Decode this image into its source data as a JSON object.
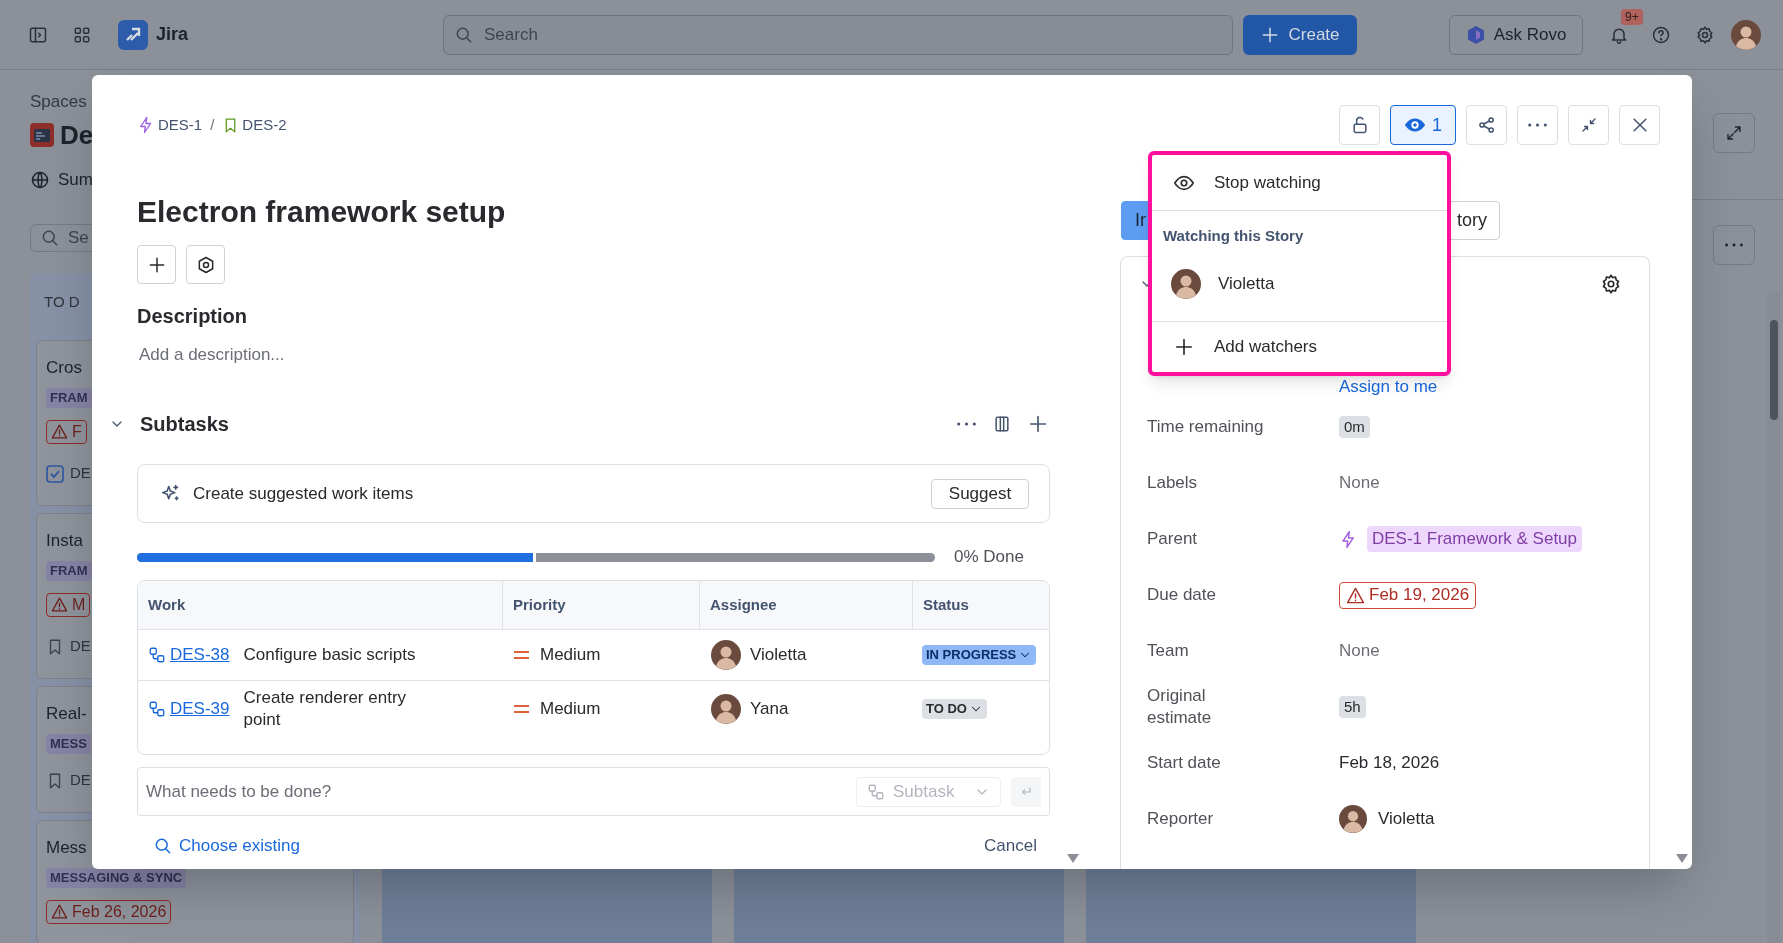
{
  "top_bar": {
    "app_name": "Jira",
    "search_placeholder": "Search",
    "create_button": "Create",
    "ask_rovo_button": "Ask Rovo",
    "notification_count": "9+"
  },
  "space": {
    "heading": "Spaces",
    "project_name": "De",
    "nav_item": "Sum",
    "search_placeholder": "Se"
  },
  "board": {
    "column_title": "TO D",
    "cards": [
      {
        "title": "Cros",
        "tag": "FRAM",
        "due": "F",
        "key": "DE",
        "kind": "task"
      },
      {
        "title": "Insta",
        "tag": "FRAM",
        "due": "M",
        "key": "DE",
        "kind": "story"
      },
      {
        "title": "Real-",
        "tag": "MESS",
        "key": "DE",
        "kind": "story"
      },
      {
        "title": "Mess",
        "tag": "MESSAGING & SYNC",
        "due": "Feb 26, 2026"
      }
    ]
  },
  "issue": {
    "breadcrumbs": [
      {
        "key": "DES-1",
        "kind": "epic"
      },
      {
        "key": "DES-2",
        "kind": "story"
      }
    ],
    "breadcrumb_separator": "/",
    "watch": {
      "count": "1",
      "selected": true
    },
    "title": "Electron framework setup",
    "description": {
      "heading": "Description",
      "placeholder": "Add a description..."
    },
    "subtasks": {
      "heading": "Subtasks",
      "expanded": true,
      "suggest": {
        "text": "Create suggested work items",
        "button": "Suggest"
      },
      "progress": {
        "level": 0.5,
        "reading": "0% Done"
      },
      "table": {
        "columns": [
          "Work",
          "Priority",
          "Assignee",
          "Status"
        ],
        "rows": [
          {
            "key": "DES-38",
            "summary": "Configure basic scripts",
            "priority": "Medium",
            "assignee": "Violetta",
            "status": {
              "text": "IN PROGRESS",
              "kind": "in_progress"
            }
          },
          {
            "key": "DES-39",
            "summary": "Create renderer entry point",
            "priority": "Medium",
            "assignee": "Yana",
            "status": {
              "text": "TO DO",
              "kind": "todo"
            }
          }
        ]
      },
      "new_item": {
        "placeholder": "What needs to be done?",
        "type": "Subtask"
      },
      "choose_existing": "Choose existing",
      "cancel": "Cancel"
    },
    "detail_tabs": [
      {
        "label": "Ir",
        "selected": true
      },
      {
        "label": "tory",
        "selected": false
      }
    ],
    "details": {
      "assign_link": "Assign to me",
      "fields": [
        {
          "label": "Time remaining",
          "value": "0m",
          "kind": "chip"
        },
        {
          "label": "Labels",
          "value": "None",
          "kind": "empty"
        },
        {
          "label": "Parent",
          "value": "DES-1 Framework & Setup",
          "kind": "parent"
        },
        {
          "label": "Due date",
          "value": "Feb 19, 2026",
          "kind": "overdue"
        },
        {
          "label": "Team",
          "value": "None",
          "kind": "empty"
        },
        {
          "label": "Original estimate",
          "value": "5h",
          "kind": "chip"
        },
        {
          "label": "Start date",
          "value": "Feb 18, 2026",
          "kind": "text"
        },
        {
          "label": "Reporter",
          "value": "Violetta",
          "kind": "user"
        }
      ]
    },
    "watchers_popover": {
      "stop_watching": "Stop watching",
      "heading": "Watching this Story",
      "watchers": [
        {
          "name": "Violetta"
        }
      ],
      "add_watchers": "Add watchers"
    }
  }
}
